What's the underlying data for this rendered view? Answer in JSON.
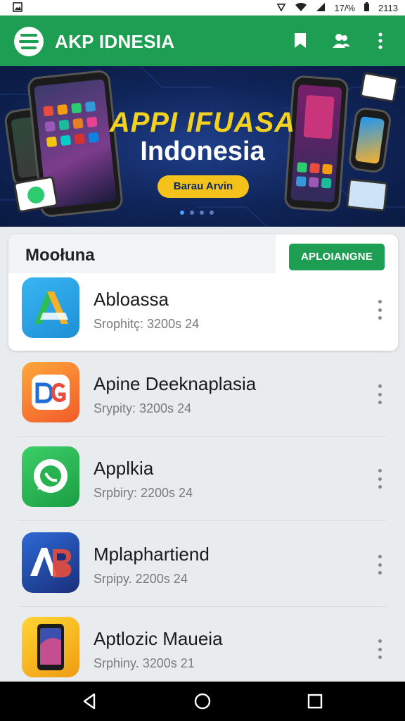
{
  "status": {
    "battery_text": "17/%",
    "time": "2113",
    "icons": [
      "image-icon",
      "signal-off-icon",
      "wifi-icon",
      "cell-signal-icon",
      "battery-icon"
    ]
  },
  "appbar": {
    "title": "AKP IDNESIA",
    "actions": [
      "bookmark-icon",
      "people-icon",
      "more-vert-icon"
    ]
  },
  "banner": {
    "title": "APPI IFUASA",
    "subtitle": "Indonesia",
    "button_label": "Barau Arvin",
    "dots": 4,
    "active_dot": 0
  },
  "section": {
    "title": "Moołuna",
    "action_label": "APLOIANGNE"
  },
  "apps": [
    {
      "name": "Abloassa",
      "meta": "Srophitç: 3200s 24",
      "icon": "arrow-logo-icon",
      "colors": [
        "#2aa7e6",
        "#f6b12a",
        "#2dbd57"
      ]
    },
    {
      "name": "Apine Deeknaplasia",
      "meta": "Srypity: 3200s 24",
      "icon": "dg-logo-icon",
      "colors": [
        "#f15a2b",
        "#ffa83a"
      ]
    },
    {
      "name": "Applkia",
      "meta": "Srpbiry: 2200s 24",
      "icon": "chat-bubble-icon",
      "colors": [
        "#33c25e",
        "#1b9e45"
      ]
    },
    {
      "name": "Mplaphartiend",
      "meta": "Srpipy. 2200s 24",
      "icon": "ab-logo-icon",
      "colors": [
        "#1f3f9a",
        "#2c6ad6"
      ]
    },
    {
      "name": "Aptlozic Maueia",
      "meta": "Srphiny. 3200s 21",
      "icon": "phone-device-icon",
      "colors": [
        "#f5c51a",
        "#f09c14"
      ]
    }
  ],
  "nav": [
    "back-icon",
    "home-icon",
    "recents-icon"
  ]
}
